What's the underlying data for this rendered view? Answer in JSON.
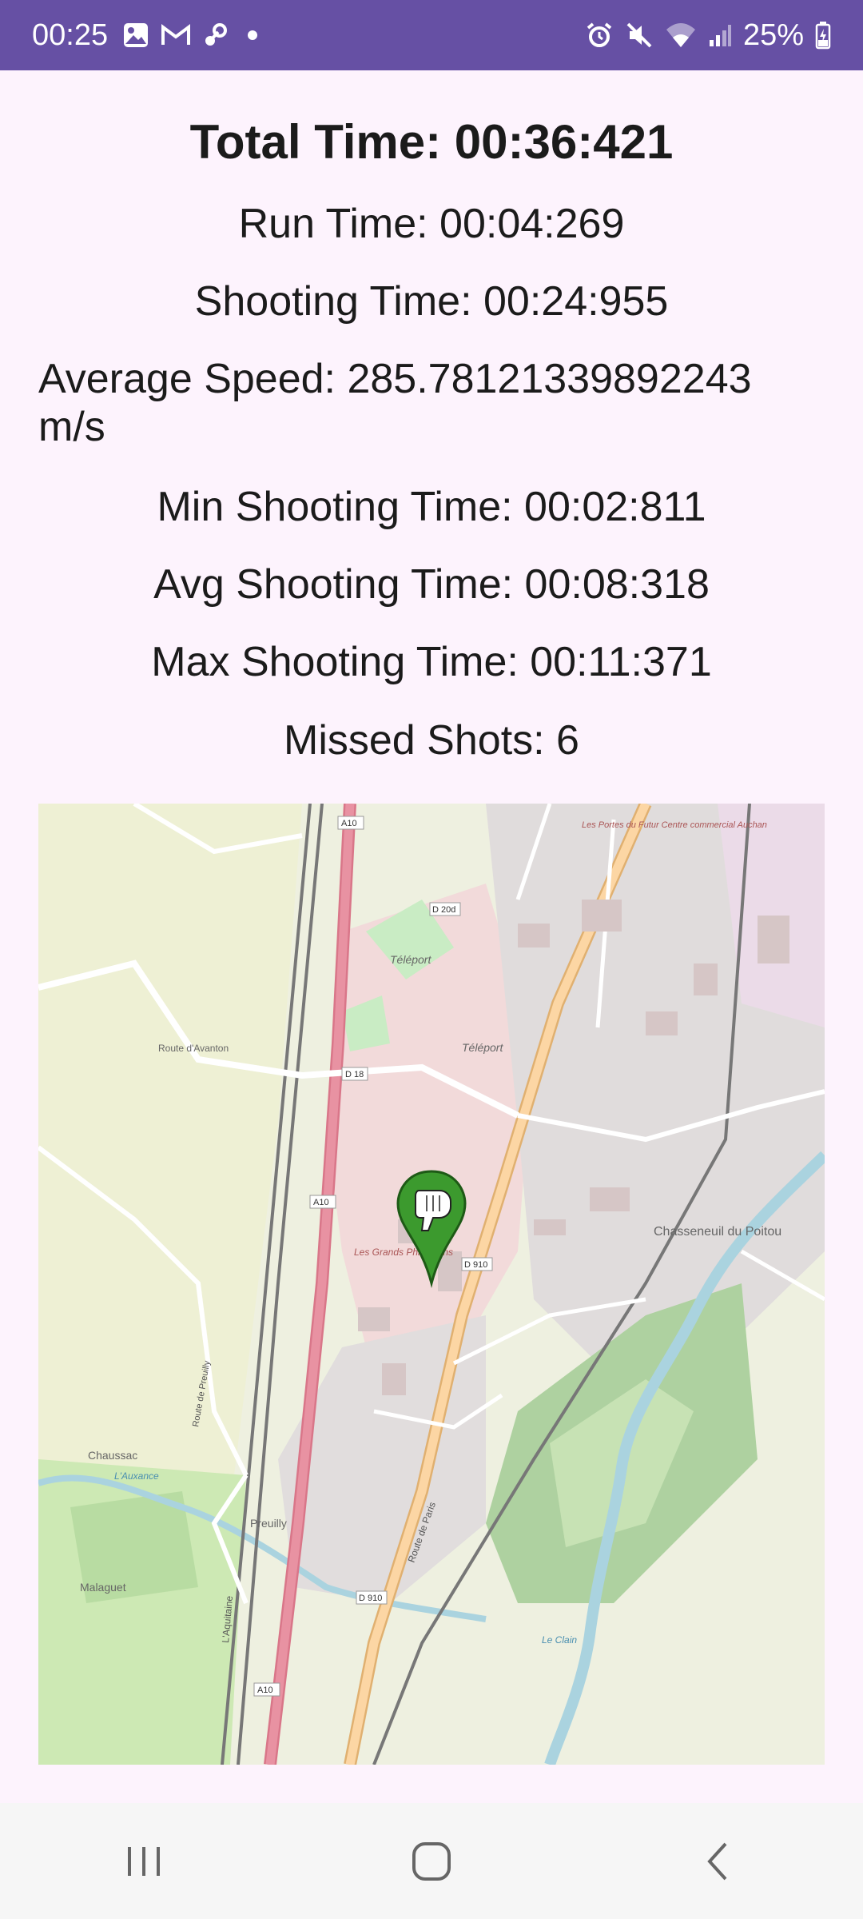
{
  "status_bar": {
    "time": "00:25",
    "battery": "25%",
    "left_icons": [
      "gallery-icon",
      "gmail-icon",
      "steam-icon",
      "dot-icon"
    ],
    "right_icons": [
      "alarm-icon",
      "mute-icon",
      "wifi-icon",
      "signal-icon",
      "battery-icon"
    ]
  },
  "stats": {
    "total_time": "Total Time: 00:36:421",
    "run_time": "Run Time: 00:04:269",
    "shooting_time": "Shooting Time: 00:24:955",
    "average_speed": "Average Speed: 285.78121339892243 m/s",
    "min_shooting_time": "Min Shooting Time: 00:02:811",
    "avg_shooting_time": "Avg Shooting Time: 00:08:318",
    "max_shooting_time": "Max Shooting Time: 00:11:371",
    "missed_shots": "Missed Shots: 6"
  },
  "map": {
    "labels": {
      "teleport": "Téléport",
      "chasseneuil": "Chasseneuil du Poitou",
      "grands_philambins": "Les Grands Philambins",
      "chaussac": "Chaussac",
      "malaguet": "Malaguet",
      "preuilly": "Preuilly",
      "auchan": "Les Portes du Futur Centre commercial Auchan",
      "a10": "A10",
      "d18": "D 18",
      "d910": "D 910",
      "d20d": "D 20d",
      "aquitaine": "L'Aquitaine",
      "route_avanton": "Route d'Avanton",
      "route_paris": "Route de Paris",
      "le_clain": "Le Clain",
      "auxance": "L'Auxance",
      "route_preuilly": "Route de Preuilly"
    },
    "marker_icon": "hand-pointer-icon"
  },
  "nav_bar": {
    "buttons": [
      "recents-icon",
      "home-icon",
      "back-icon"
    ]
  },
  "colors": {
    "status_bar": "#6650a4",
    "background": "#fdf3fd",
    "marker": "#3c9a2e",
    "highway": "#e892a2",
    "primary_road": "#fcd6a4"
  }
}
